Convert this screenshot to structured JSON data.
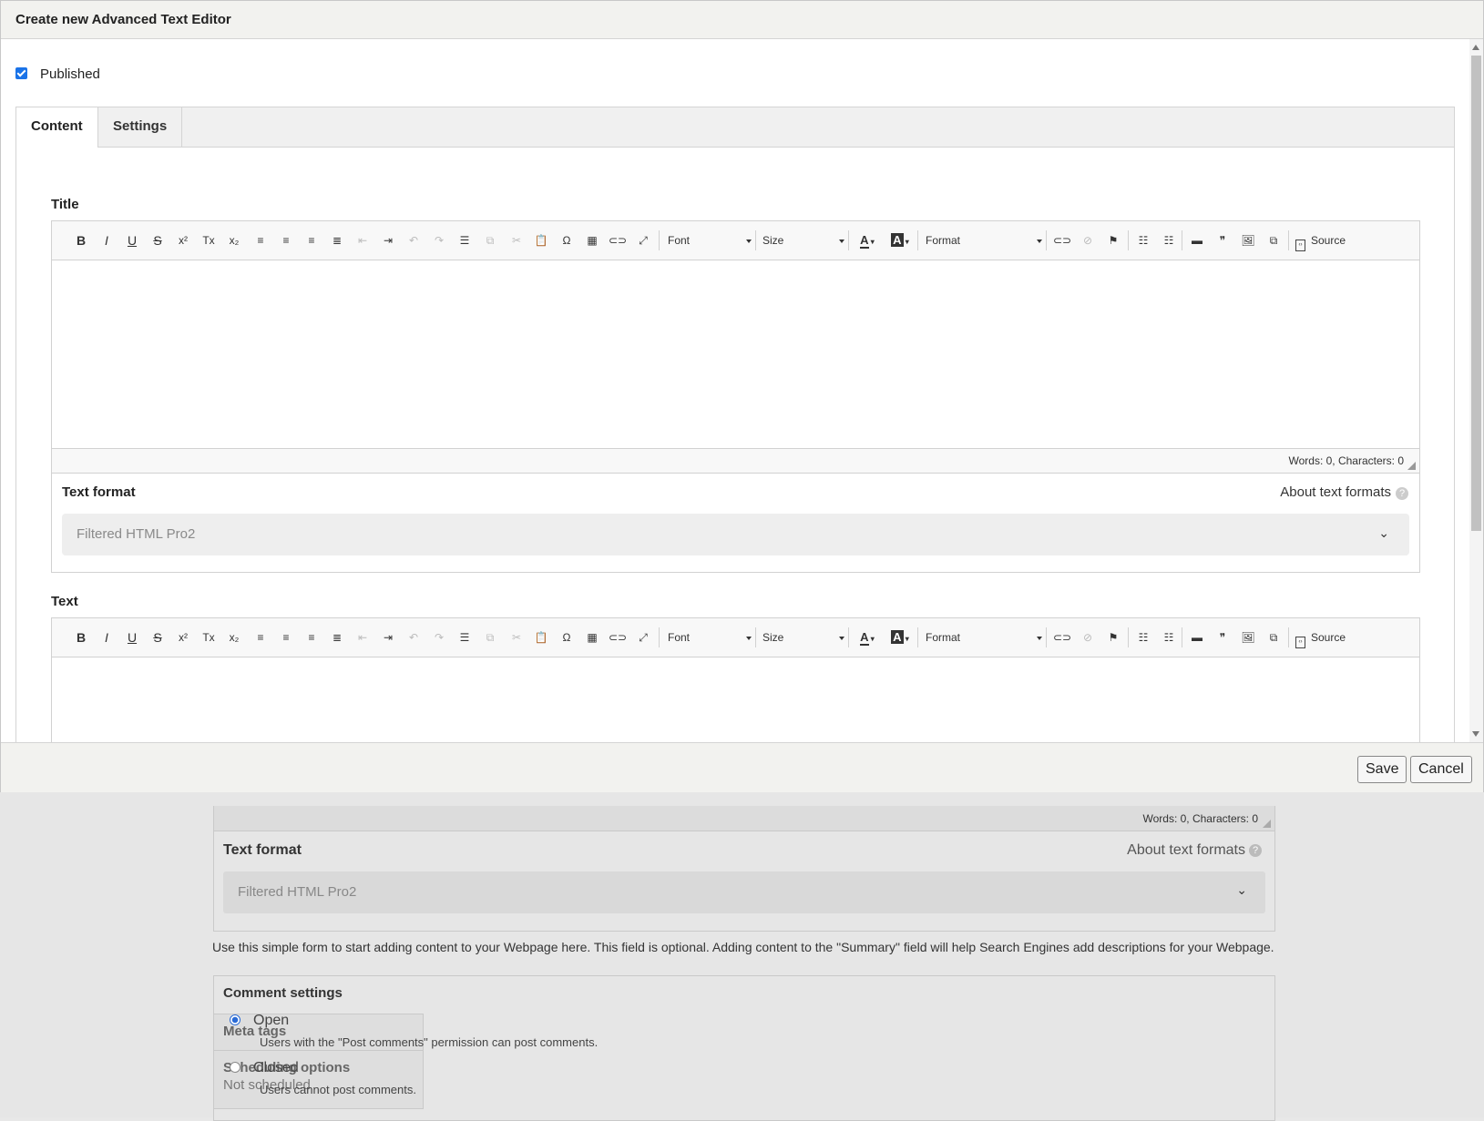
{
  "background": {
    "word_count": "Words: 0, Characters: 0",
    "text_format_label": "Text format",
    "about_text_formats": "About text formats",
    "help_icon": "?",
    "format_value": "Filtered HTML Pro2",
    "chevron": "⌄",
    "help_text": "Use this simple form to start adding content to your Webpage here. This field is optional. Adding content to the \"Summary\" field will help Search Engines add descriptions for your Webpage.",
    "vertical_tabs": [
      {
        "label": "Comment settings",
        "summary": ""
      },
      {
        "label": "Meta tags",
        "summary": ""
      },
      {
        "label": "Scheduling options",
        "summary": "Not scheduled"
      }
    ],
    "comment_options": [
      {
        "label": "Open",
        "description": "Users with the \"Post comments\" permission can post comments.",
        "selected": true
      },
      {
        "label": "Closed",
        "description": "Users cannot post comments.",
        "selected": false
      }
    ]
  },
  "modal": {
    "title": "Create new Advanced Text Editor",
    "published_label": "Published",
    "published_checked": true,
    "tabs": [
      {
        "label": "Content",
        "active": true
      },
      {
        "label": "Settings",
        "active": false
      }
    ],
    "toolbar": {
      "buttons": [
        {
          "glyph": "B",
          "name": "bold-icon"
        },
        {
          "glyph": "I",
          "name": "italic-icon"
        },
        {
          "glyph": "U",
          "name": "underline-icon"
        },
        {
          "glyph": "S",
          "name": "strikethrough-icon"
        },
        {
          "glyph": "x²",
          "name": "superscript-icon"
        },
        {
          "glyph": "Tx",
          "name": "remove-format-icon"
        },
        {
          "glyph": "x₂",
          "name": "subscript-icon"
        },
        {
          "glyph": "≡",
          "name": "align-left-icon"
        },
        {
          "glyph": "≡",
          "name": "align-right-icon"
        },
        {
          "glyph": "≡",
          "name": "align-center-icon"
        },
        {
          "glyph": "≣",
          "name": "justify-icon"
        },
        {
          "glyph": "⇤",
          "name": "outdent-icon"
        },
        {
          "glyph": "⇥",
          "name": "indent-icon"
        },
        {
          "glyph": "↶",
          "name": "undo-icon"
        },
        {
          "glyph": "↷",
          "name": "redo-icon"
        },
        {
          "glyph": "☰",
          "name": "horizontal-rule-icon"
        },
        {
          "glyph": "⧉",
          "name": "copy-icon"
        },
        {
          "glyph": "✂",
          "name": "cut-icon"
        },
        {
          "glyph": "📋",
          "name": "paste-icon"
        },
        {
          "glyph": "Ω",
          "name": "special-char-icon"
        },
        {
          "glyph": "▦",
          "name": "table-icon"
        },
        {
          "glyph": "⊂⊃",
          "name": "link-icon"
        },
        {
          "glyph": "⤢",
          "name": "maximize-icon"
        }
      ],
      "font_label": "Font",
      "size_label": "Size",
      "format_label": "Format",
      "text_color_glyph": "A",
      "bg_color_glyph": "A",
      "right_buttons": [
        {
          "glyph": "⊂⊃",
          "name": "link-icon"
        },
        {
          "glyph": "⊘",
          "name": "unlink-icon"
        },
        {
          "glyph": "⚑",
          "name": "anchor-flag-icon"
        },
        {
          "glyph": "☷",
          "name": "bulleted-list-icon"
        },
        {
          "glyph": "☷",
          "name": "numbered-list-icon"
        },
        {
          "glyph": "▬",
          "name": "iframe-icon"
        },
        {
          "glyph": "❞",
          "name": "blockquote-icon"
        },
        {
          "glyph": "🖼",
          "name": "image-icon"
        },
        {
          "glyph": "⧉",
          "name": "media-icon"
        }
      ],
      "source_label": "Source",
      "source_icon": "‹›"
    },
    "title_field": {
      "label": "Title",
      "word_count": "Words: 0, Characters: 0",
      "text_format_label": "Text format",
      "about_text_formats": "About text formats",
      "help_icon": "?",
      "format_value": "Filtered HTML Pro2",
      "chevron": "⌄"
    },
    "text_field": {
      "label": "Text"
    },
    "save_label": "Save",
    "cancel_label": "Cancel"
  }
}
